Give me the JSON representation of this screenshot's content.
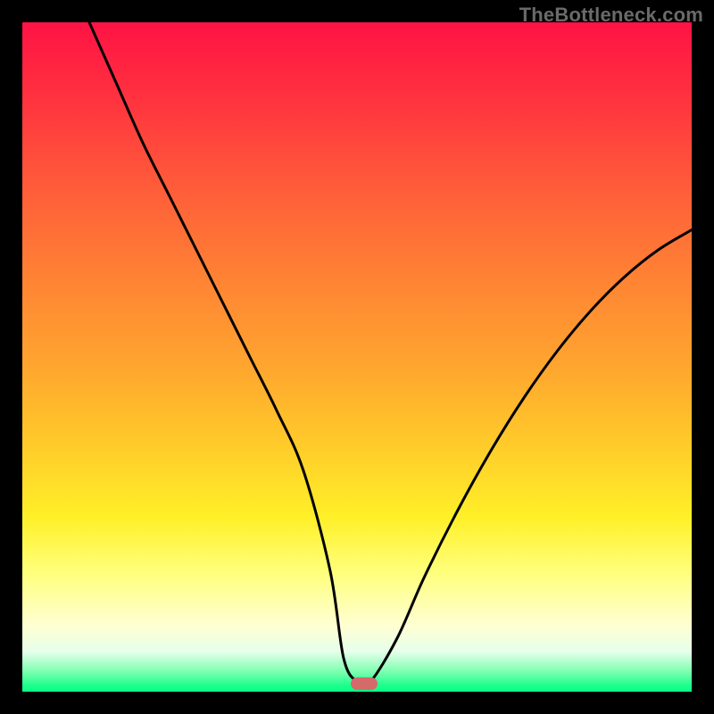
{
  "watermark": "TheBottleneck.com",
  "chart_data": {
    "type": "line",
    "title": "",
    "xlabel": "",
    "ylabel": "",
    "xlim": [
      0,
      100
    ],
    "ylim": [
      0,
      100
    ],
    "grid": false,
    "legend": false,
    "marker": {
      "x": 51,
      "y": 1.2
    },
    "series": [
      {
        "name": "bottleneck-curve",
        "x": [
          10,
          14,
          18,
          22,
          26,
          30,
          34,
          38,
          42,
          46,
          48,
          50,
          52,
          56,
          60,
          65,
          70,
          75,
          80,
          85,
          90,
          95,
          100
        ],
        "y": [
          100,
          91,
          82,
          74,
          66,
          58,
          50,
          42,
          33,
          18,
          5,
          1.5,
          1.5,
          8,
          17,
          27,
          36,
          44,
          51,
          57,
          62,
          66,
          69
        ]
      }
    ],
    "background_gradient": {
      "direction": "vertical",
      "stops": [
        {
          "pos": 0,
          "color": "#ff1345"
        },
        {
          "pos": 24,
          "color": "#ff5a3a"
        },
        {
          "pos": 52,
          "color": "#ffa72e"
        },
        {
          "pos": 74,
          "color": "#fff028"
        },
        {
          "pos": 90,
          "color": "#ffffd2"
        },
        {
          "pos": 100,
          "color": "#09ff85"
        }
      ]
    }
  }
}
